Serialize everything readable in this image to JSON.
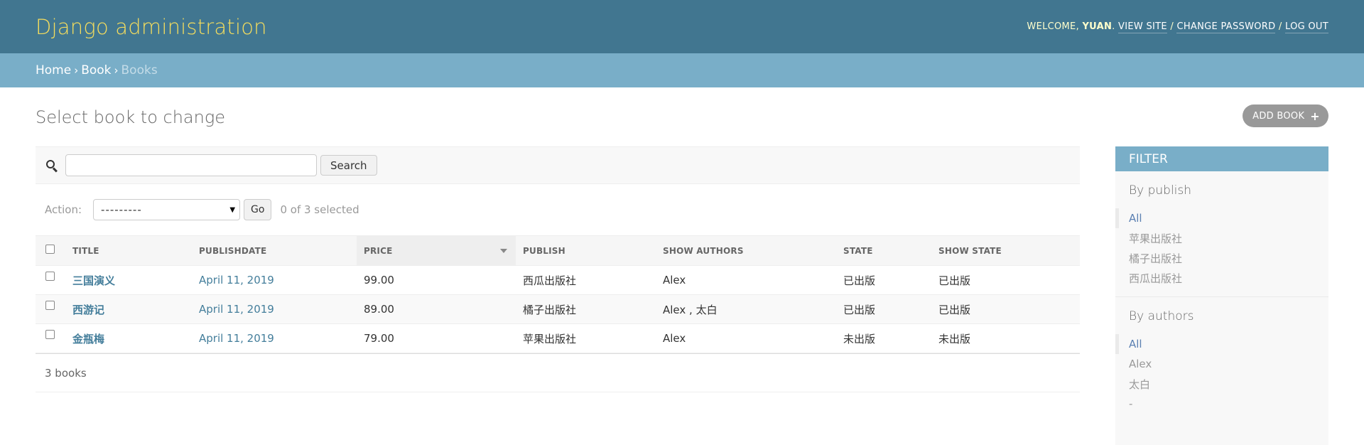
{
  "header": {
    "site_title": "Django administration",
    "welcome": "Welcome,",
    "username": "yuan",
    "view_site": "View site",
    "change_password": "Change password",
    "log_out": "Log out",
    "separator": "/"
  },
  "breadcrumbs": {
    "home": "Home",
    "app": "Book",
    "current": "Books",
    "arrow": "›"
  },
  "page": {
    "title": "Select book to change",
    "add_button": "Add book",
    "add_icon": "+"
  },
  "search": {
    "value": "",
    "placeholder": "",
    "button": "Search"
  },
  "actions": {
    "label": "Action:",
    "selected_option": "---------",
    "go": "Go",
    "selected_count": "0 of 3 selected"
  },
  "table": {
    "columns": [
      "Title",
      "Publishdate",
      "Price",
      "Publish",
      "Show authors",
      "State",
      "Show state"
    ],
    "rows": [
      {
        "title": "三国演义",
        "date": "April 11, 2019",
        "price": "99.00",
        "publish": "西瓜出版社",
        "authors": "Alex",
        "state": "已出版",
        "show_state": "已出版"
      },
      {
        "title": "西游记",
        "date": "April 11, 2019",
        "price": "89.00",
        "publish": "橘子出版社",
        "authors": "Alex , 太白",
        "state": "已出版",
        "show_state": "已出版"
      },
      {
        "title": "金瓶梅",
        "date": "April 11, 2019",
        "price": "79.00",
        "publish": "苹果出版社",
        "authors": "Alex",
        "state": "未出版",
        "show_state": "未出版"
      }
    ],
    "footer": "3 books"
  },
  "filter": {
    "title": "Filter",
    "groups": [
      {
        "title": "By publish",
        "items": [
          "All",
          "苹果出版社",
          "橘子出版社",
          "西瓜出版社"
        ]
      },
      {
        "title": "By authors",
        "items": [
          "All",
          "Alex",
          "太白",
          "-"
        ]
      }
    ]
  },
  "icons": {
    "search": "search-icon",
    "select_caret": "caret-down-icon",
    "sort": "sort-desc-icon",
    "add": "plus-icon"
  },
  "colors": {
    "header_bg": "#417690",
    "breadcrumb_bg": "#79aec8",
    "site_title": "#f5dd5d",
    "link": "#447e9b",
    "add_button_bg": "#999999"
  }
}
